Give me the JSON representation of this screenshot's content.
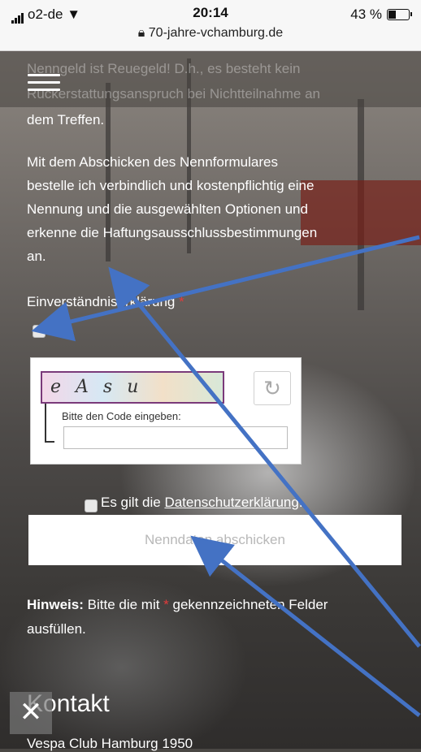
{
  "status_bar": {
    "carrier": "o2-de",
    "time": "20:14",
    "battery": "43 %",
    "url": "70-jahre-vchamburg.de",
    "battery_level": 0.43
  },
  "intro": {
    "line1": "Nenngeld ist Reuegeld! D.h., es besteht kein",
    "line2": "Rückerstattungsanspruch bei Nichtteilnahme an",
    "line3": "dem Treffen."
  },
  "agreement_text": [
    "Mit dem Abschicken des Nennformulares",
    "bestelle ich verbindlich und kostenpflichtig eine",
    "Nennung und die ausgewählten Optionen und",
    "erkenne die Haftungsausschlussbestimmungen",
    "an."
  ],
  "consent": {
    "label": "Einverständniserklärung",
    "required_mark": "*"
  },
  "captcha": {
    "image_text": "eAsu",
    "refresh_icon": "refresh-icon",
    "prompt": "Bitte den Code eingeben:",
    "input_value": ""
  },
  "privacy": {
    "prefix": "Es gilt die ",
    "link": "Datenschutzerklärung",
    "suffix": "."
  },
  "submit_label": "Nenndaten abschicken",
  "note": {
    "bold": "Hinweis:",
    "text1": " Bitte die mit ",
    "required_mark": "*",
    "text2": " gekennzeichneten Felder",
    "text3": "ausfüllen."
  },
  "footer": {
    "heading": "Kontakt",
    "club": "Vespa Club Hamburg 1950"
  },
  "colors": {
    "annotation_arrow": "#4472c4",
    "required": "#e23b3b"
  }
}
